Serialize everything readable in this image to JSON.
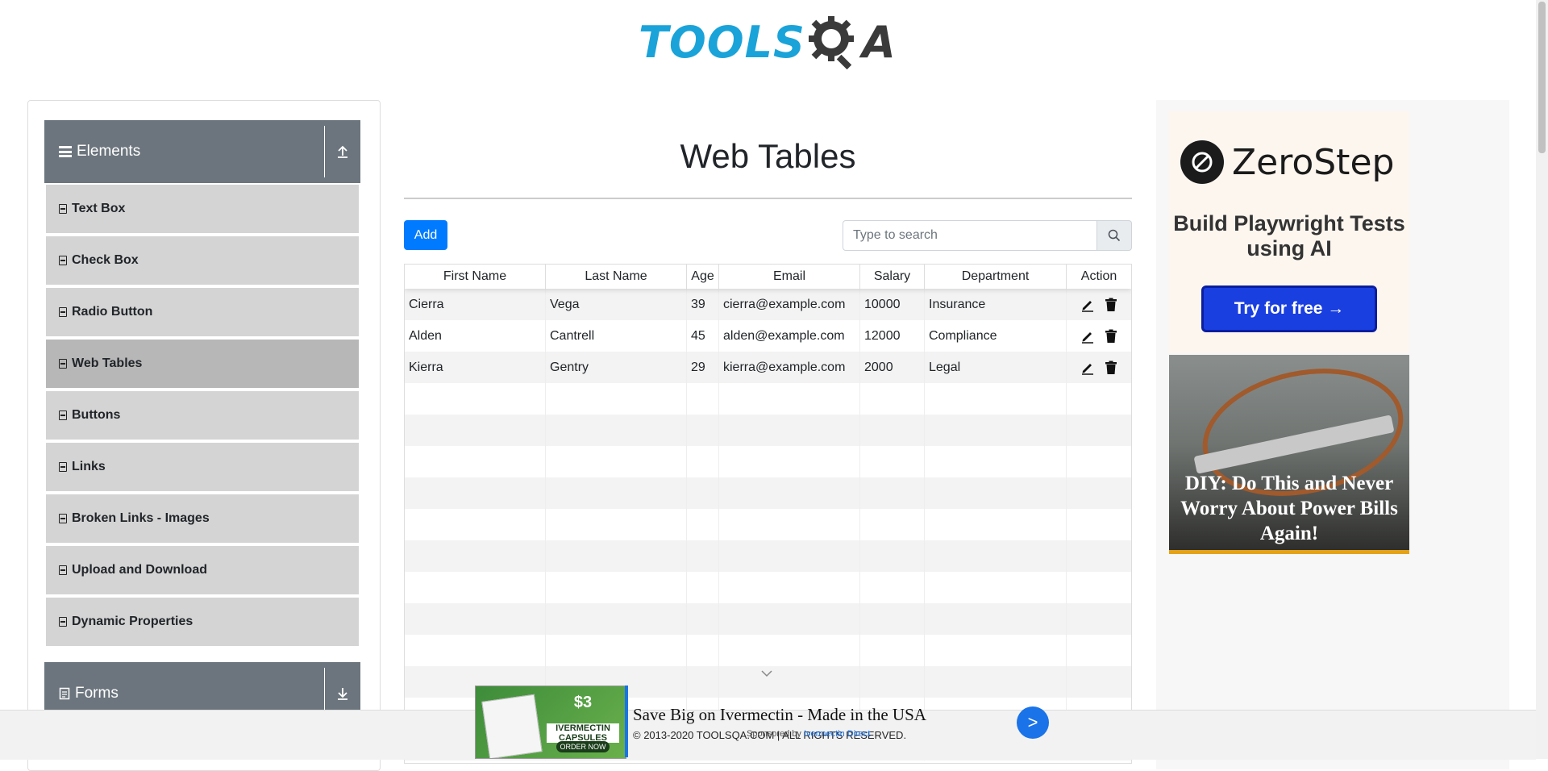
{
  "header": {
    "logo_text": "TOOLS",
    "logo_suffix": "A"
  },
  "sidebar": {
    "groups": [
      {
        "label": "Elements"
      },
      {
        "label": "Forms"
      }
    ],
    "items": [
      {
        "label": "Text Box"
      },
      {
        "label": "Check Box"
      },
      {
        "label": "Radio Button"
      },
      {
        "label": "Web Tables",
        "active": true
      },
      {
        "label": "Buttons"
      },
      {
        "label": "Links"
      },
      {
        "label": "Broken Links - Images"
      },
      {
        "label": "Upload and Download"
      },
      {
        "label": "Dynamic Properties"
      }
    ]
  },
  "main": {
    "title": "Web Tables",
    "add_label": "Add",
    "search_placeholder": "Type to search",
    "columns": [
      "First Name",
      "Last Name",
      "Age",
      "Email",
      "Salary",
      "Department",
      "Action"
    ],
    "rows": [
      {
        "first": "Cierra",
        "last": "Vega",
        "age": "39",
        "email": "cierra@example.com",
        "salary": "10000",
        "dept": "Insurance"
      },
      {
        "first": "Alden",
        "last": "Cantrell",
        "age": "45",
        "email": "alden@example.com",
        "salary": "12000",
        "dept": "Compliance"
      },
      {
        "first": "Kierra",
        "last": "Gentry",
        "age": "29",
        "email": "kierra@example.com",
        "salary": "2000",
        "dept": "Legal"
      }
    ]
  },
  "ads": {
    "zerostep_name": "ZeroStep",
    "zerostep_tagline": "Build Playwright Tests using AI",
    "zerostep_cta": "Try for free →",
    "diy_text": "DIY: Do This and Never Worry About Power Bills Again!",
    "bottom_price": "$3",
    "bottom_caps": "IVERMECTIN CAPSULES",
    "bottom_order": "ORDER NOW",
    "bottom_title": "Save Big on Ivermectin - Made in the USA",
    "bottom_sponsor_prefix": "Sponsored by",
    "bottom_sponsor_name": "Ivermectin Direct",
    "bottom_go": ">"
  },
  "footer": {
    "copyright": "© 2013-2020 TOOLSQA.COM | ALL RIGHTS RESERVED."
  },
  "colors": {
    "accent": "#007bff",
    "sidebar_header": "#6c757d",
    "menu_item": "#d4d4d4",
    "menu_item_active": "#b7b7b7",
    "logo_blue": "#1aa3d9"
  }
}
